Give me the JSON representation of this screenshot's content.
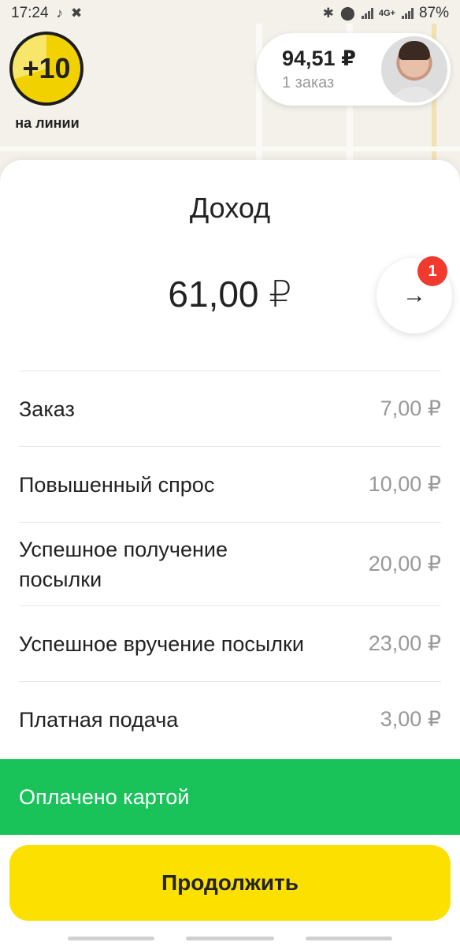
{
  "status_bar": {
    "time": "17:24",
    "network": "4G+",
    "battery": "87%",
    "icons": [
      "music-note-icon",
      "app-icon",
      "bluetooth-icon",
      "location-icon",
      "signal-icon",
      "signal-icon",
      "battery-icon"
    ]
  },
  "line_badge": {
    "value": "+10",
    "label": "на линии"
  },
  "earnings_pill": {
    "amount": "94,51 ₽",
    "orders": "1 заказ"
  },
  "sheet": {
    "title": "Доход",
    "total": "61,00 ₽",
    "notification_count": "1",
    "arrow_icon": "arrow-right-icon"
  },
  "income_rows": [
    {
      "label": "Заказ",
      "value": "7,00 ₽"
    },
    {
      "label": "Повышенный спрос",
      "value": "10,00 ₽"
    },
    {
      "label": "Успешное получение посылки",
      "value": "20,00 ₽"
    },
    {
      "label": "Успешное вручение посылки",
      "value": "23,00 ₽"
    },
    {
      "label": "Платная подача",
      "value": "3,00 ₽"
    }
  ],
  "payment": {
    "text": "Оплачено картой"
  },
  "continue_button": {
    "label": "Продолжить"
  },
  "colors": {
    "accent_yellow": "#fce000",
    "paid_green": "#1ac35a",
    "notification_red": "#f03a2e"
  }
}
